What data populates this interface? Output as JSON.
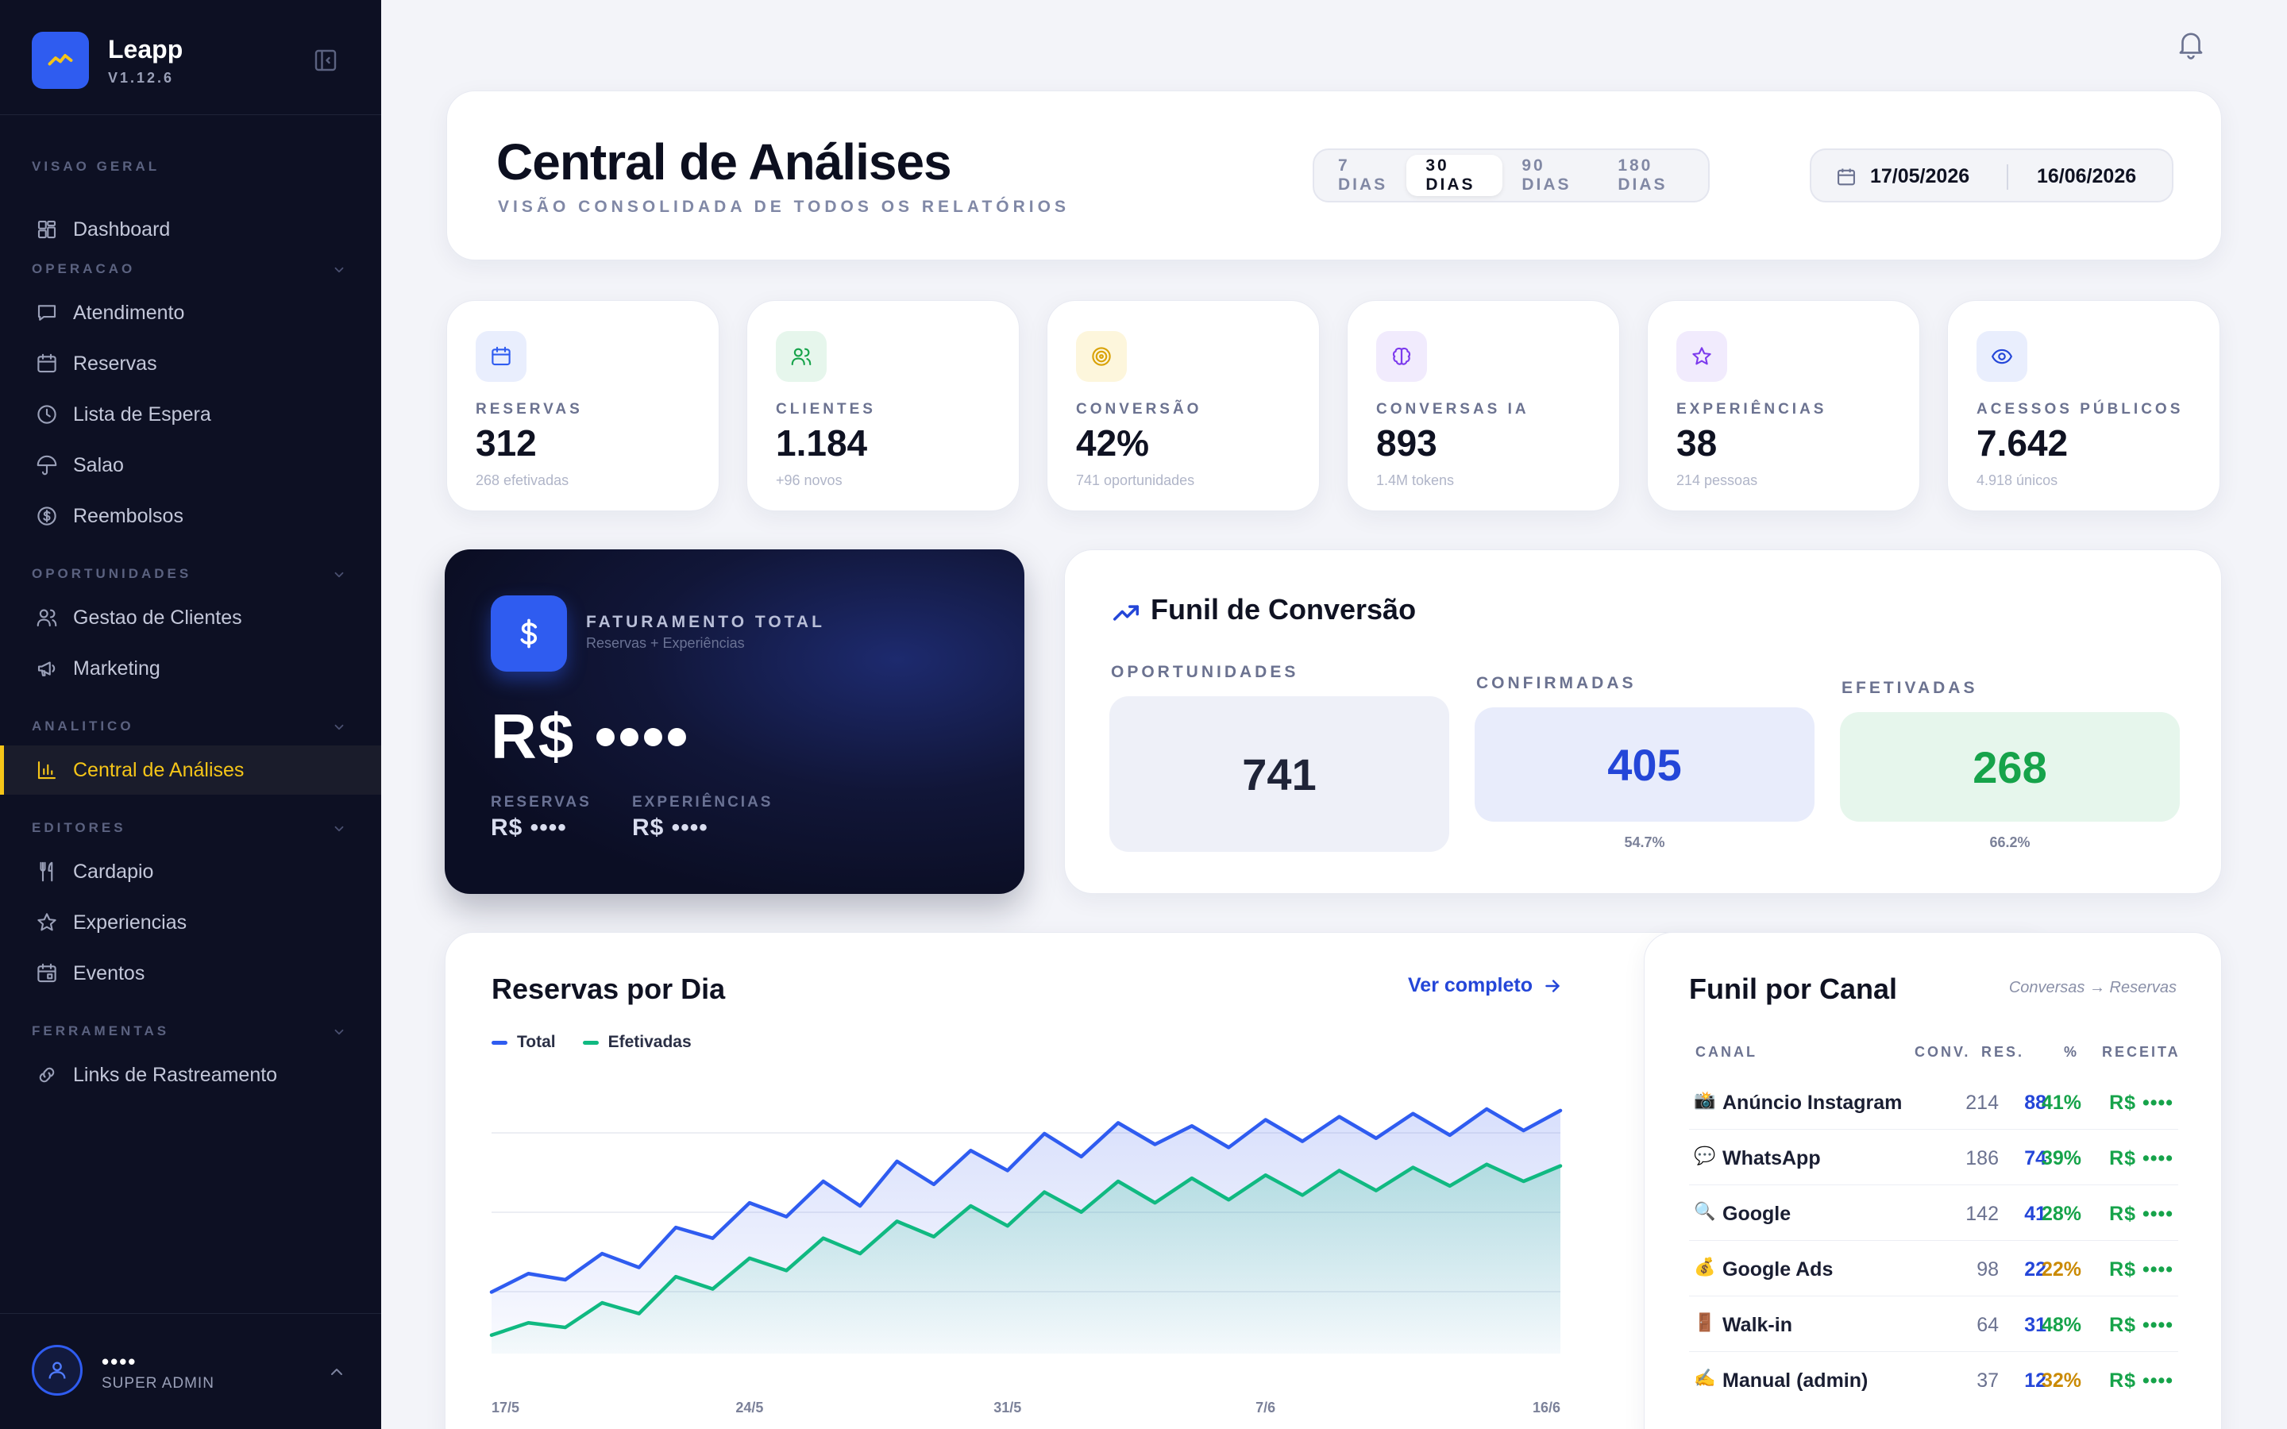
{
  "app": {
    "name": "Leapp",
    "version": "V1.12.6"
  },
  "sidebar": {
    "sections": [
      {
        "title": "VISAO GERAL",
        "items": [
          {
            "label": "Dashboard",
            "icon": "grid-icon"
          }
        ]
      },
      {
        "title": "OPERACAO",
        "items": [
          {
            "label": "Atendimento",
            "icon": "chat-icon"
          },
          {
            "label": "Reservas",
            "icon": "calendar-icon"
          },
          {
            "label": "Lista de Espera",
            "icon": "clock-icon"
          },
          {
            "label": "Salao",
            "icon": "umbrella-icon"
          },
          {
            "label": "Reembolsos",
            "icon": "dollar-circle-icon"
          }
        ]
      },
      {
        "title": "OPORTUNIDADES",
        "items": [
          {
            "label": "Gestao de Clientes",
            "icon": "users-icon"
          },
          {
            "label": "Marketing",
            "icon": "megaphone-icon"
          }
        ]
      },
      {
        "title": "ANALITICO",
        "items": [
          {
            "label": "Central de Análises",
            "icon": "bar-chart-icon",
            "active": true
          }
        ]
      },
      {
        "title": "EDITORES",
        "items": [
          {
            "label": "Cardapio",
            "icon": "utensils-icon"
          },
          {
            "label": "Experiencias",
            "icon": "star-icon"
          },
          {
            "label": "Eventos",
            "icon": "calendar-event-icon"
          }
        ]
      },
      {
        "title": "FERRAMENTAS",
        "items": [
          {
            "label": "Links de Rastreamento",
            "icon": "link-icon"
          }
        ]
      }
    ],
    "user": {
      "name": "••••",
      "role": "SUPER ADMIN"
    }
  },
  "header": {
    "title": "Central de Análises",
    "subtitle": "VISÃO CONSOLIDADA DE TODOS OS RELATÓRIOS",
    "ranges": [
      "7 DIAS",
      "30 DIAS",
      "90 DIAS",
      "180 DIAS"
    ],
    "active_range": "30 DIAS",
    "date_start": "17/05/2026",
    "date_end": "16/06/2026"
  },
  "stats": [
    {
      "label": "RESERVAS",
      "value": "312",
      "sub": "268 efetivadas",
      "icon": "calendar-icon",
      "color": "#2f5cf0",
      "bg": "#e9eefd"
    },
    {
      "label": "CLIENTES",
      "value": "1.184",
      "sub": "+96 novos",
      "icon": "users-icon",
      "color": "#16a34a",
      "bg": "#e6f6ec"
    },
    {
      "label": "CONVERSÃO",
      "value": "42%",
      "sub": "741 oportunidades",
      "icon": "target-icon",
      "color": "#d9a206",
      "bg": "#fdf6dc"
    },
    {
      "label": "CONVERSAS IA",
      "value": "893",
      "sub": "1.4M tokens",
      "icon": "brain-icon",
      "color": "#7c3aed",
      "bg": "#f1ebfd"
    },
    {
      "label": "EXPERIÊNCIAS",
      "value": "38",
      "sub": "214 pessoas",
      "icon": "star-icon",
      "color": "#7c3aed",
      "bg": "#f1ebfd"
    },
    {
      "label": "ACESSOS PÚBLICOS",
      "value": "7.642",
      "sub": "4.918 únicos",
      "icon": "eye-icon",
      "color": "#2446d8",
      "bg": "#e9eefd"
    }
  ],
  "revenue": {
    "title": "FATURAMENTO TOTAL",
    "subtitle": "Reservas + Experiências",
    "value": "R$ ••••",
    "reservas_label": "RESERVAS",
    "reservas_value": "R$ ••••",
    "experiencias_label": "EXPERIÊNCIAS",
    "experiencias_value": "R$ ••••"
  },
  "funnel": {
    "title": "Funil de Conversão",
    "stages": [
      {
        "label": "OPORTUNIDADES",
        "value": "741",
        "pct": "",
        "color": "#1f2438",
        "bg": "#eef0f8"
      },
      {
        "label": "CONFIRMADAS",
        "value": "405",
        "pct": "54.7%",
        "color": "#2446d8",
        "bg": "#e8ecfb"
      },
      {
        "label": "EFETIVADAS",
        "value": "268",
        "pct": "66.2%",
        "color": "#16a34a",
        "bg": "#e6f6ec"
      }
    ]
  },
  "reservas_chart": {
    "title": "Reservas por Dia",
    "link": "Ver completo",
    "legend": [
      {
        "name": "Total",
        "color": "#2f5cf0"
      },
      {
        "name": "Efetivadas",
        "color": "#10b981"
      }
    ]
  },
  "chart_data": {
    "type": "area",
    "title": "Reservas por Dia",
    "x_tick_labels": [
      "17/5",
      "24/5",
      "31/5",
      "7/6",
      "16/6"
    ],
    "ylim": [
      0,
      16
    ],
    "grid": true,
    "legend_position": "top-left",
    "series": [
      {
        "name": "Total",
        "color": "#2f5cf0",
        "values": [
          4.0,
          5.2,
          4.8,
          6.5,
          5.6,
          8.2,
          7.5,
          9.8,
          8.9,
          11.2,
          9.6,
          12.5,
          11.0,
          13.2,
          11.9,
          14.3,
          12.8,
          15.0,
          13.6,
          14.8,
          13.4,
          15.2,
          13.8,
          15.4,
          14.0,
          15.6,
          14.2,
          15.9,
          14.5,
          15.8
        ]
      },
      {
        "name": "Efetivadas",
        "color": "#10b981",
        "values": [
          1.2,
          2.0,
          1.7,
          3.3,
          2.6,
          5.0,
          4.2,
          6.2,
          5.4,
          7.5,
          6.5,
          8.6,
          7.6,
          9.6,
          8.3,
          10.5,
          9.2,
          11.2,
          9.8,
          11.4,
          10.0,
          11.6,
          10.3,
          11.9,
          10.6,
          12.1,
          10.9,
          12.3,
          11.2,
          12.2
        ]
      }
    ]
  },
  "channels": {
    "title": "Funil por Canal",
    "note": "Conversas → Reservas",
    "headers": [
      "CANAL",
      "CONV.",
      "RES.",
      "%",
      "RECEITA"
    ],
    "rows": [
      {
        "emoji": "📸",
        "name": "Anúncio Instagram",
        "conv": "214",
        "res": "88",
        "pct": "41%",
        "pct_color": "#16a34a",
        "rev": "R$ ••••"
      },
      {
        "emoji": "💬",
        "name": "WhatsApp",
        "conv": "186",
        "res": "74",
        "pct": "39%",
        "pct_color": "#16a34a",
        "rev": "R$ ••••"
      },
      {
        "emoji": "🔍",
        "name": "Google",
        "conv": "142",
        "res": "41",
        "pct": "28%",
        "pct_color": "#16a34a",
        "rev": "R$ ••••"
      },
      {
        "emoji": "💰",
        "name": "Google Ads",
        "conv": "98",
        "res": "22",
        "pct": "22%",
        "pct_color": "#ca8a04",
        "rev": "R$ ••••"
      },
      {
        "emoji": "🚪",
        "name": "Walk-in",
        "conv": "64",
        "res": "31",
        "pct": "48%",
        "pct_color": "#16a34a",
        "rev": "R$ ••••"
      },
      {
        "emoji": "✍️",
        "name": "Manual (admin)",
        "conv": "37",
        "res": "12",
        "pct": "32%",
        "pct_color": "#ca8a04",
        "rev": "R$ ••••"
      }
    ]
  }
}
